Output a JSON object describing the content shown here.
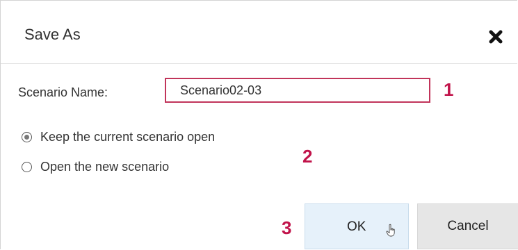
{
  "dialog": {
    "title": "Save As",
    "close_icon": "close-icon"
  },
  "form": {
    "name_label": "Scenario Name:",
    "name_value": "Scenario02-03"
  },
  "options": [
    {
      "label": "Keep the current scenario open",
      "selected": true
    },
    {
      "label": "Open the new scenario",
      "selected": false
    }
  ],
  "buttons": {
    "ok_label": "OK",
    "cancel_label": "Cancel"
  },
  "callouts": [
    "1",
    "2",
    "3"
  ],
  "colors": {
    "input_border": "#c1345a",
    "callout": "#c1134a",
    "ok_background": "#e6f1fa",
    "cancel_background": "#e6e6e6"
  },
  "cursor_icon": "hand-pointer-icon"
}
